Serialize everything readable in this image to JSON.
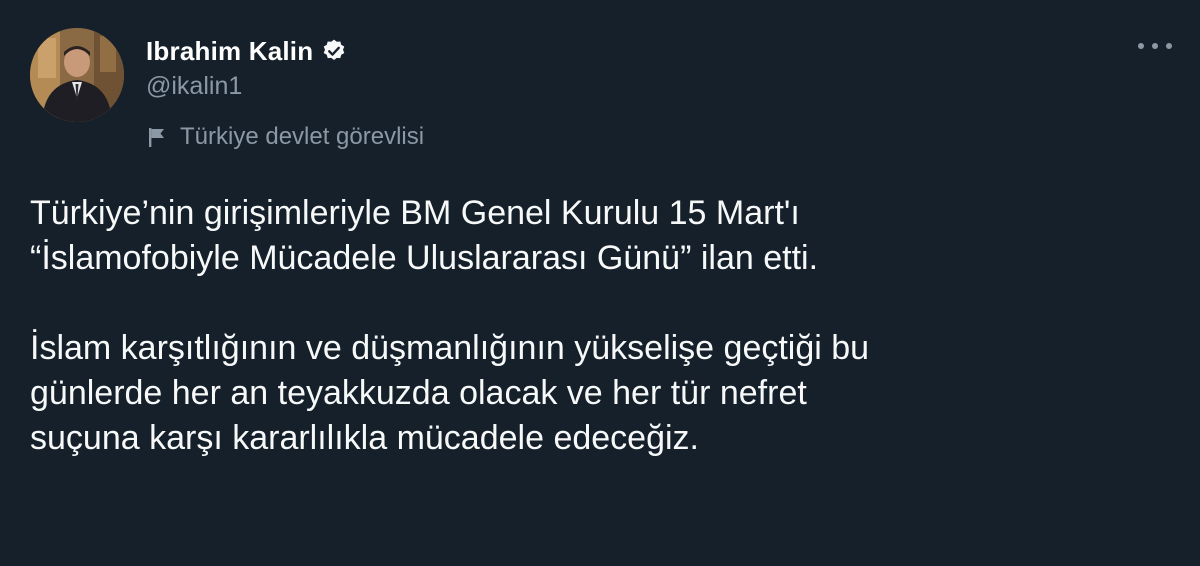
{
  "author": {
    "name": "Ibrahim Kalin",
    "handle": "@ikalin1",
    "label": "Türkiye devlet görevlisi"
  },
  "tweet": {
    "paragraph_1_line_1": "Türkiye’nin girişimleriyle BM Genel Kurulu 15 Mart'ı",
    "paragraph_1_line_2": "“İslamofobiyle Mücadele Uluslararası Günü” ilan etti.",
    "paragraph_2_line_1": "İslam karşıtlığının ve düşmanlığının yükselişe geçtiği bu",
    "paragraph_2_line_2": "günlerde her an teyakkuzda olacak ve her tür nefret",
    "paragraph_2_line_3": "suçuna karşı kararlılıkla mücadele edeceğiz."
  },
  "icons": {
    "verified": "verified-badge-icon",
    "label": "flag-icon",
    "more": "more-options-icon"
  },
  "colors": {
    "background": "#15202b",
    "text_primary": "#f7f9f9",
    "text_secondary": "#8b98a5"
  }
}
